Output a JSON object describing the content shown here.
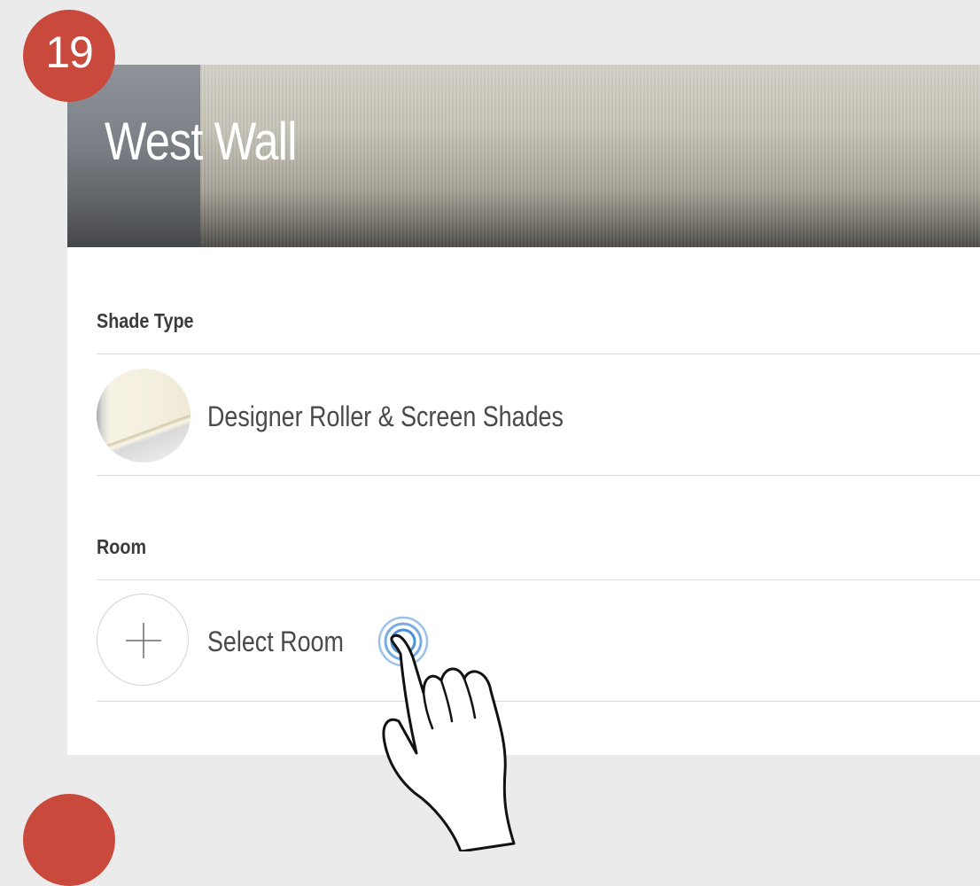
{
  "step_badge": "19",
  "header": {
    "title": "West Wall"
  },
  "shade_type": {
    "label": "Shade Type",
    "value": "Designer Roller & Screen Shades",
    "icon": "shade-thumbnail-icon"
  },
  "room": {
    "label": "Room",
    "select_label": "Select Room",
    "icon": "plus-icon"
  },
  "pointer": {
    "icon": "hand-pointer-icon"
  },
  "colors": {
    "badge": "#c94a3c",
    "background": "#ebebeb",
    "panel": "#ffffff",
    "tap_ring": "#4a90d9"
  }
}
